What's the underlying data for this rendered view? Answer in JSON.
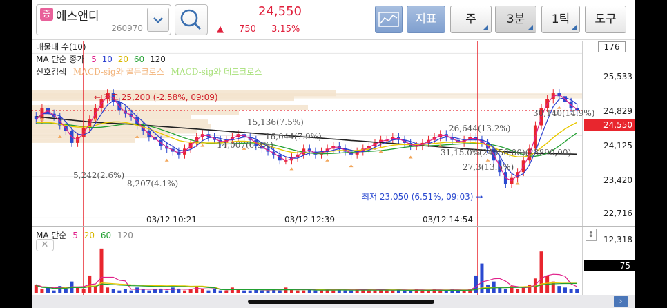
{
  "header": {
    "badge": "증",
    "stock_name": "에스앤디",
    "stock_code": "260970",
    "price": "24,550",
    "change_symbol": "▲",
    "change": "750",
    "change_pct": "3.15%",
    "buttons": {
      "indicator": "지표",
      "week": "주",
      "interval": "3분",
      "tick": "1틱",
      "tools": "도구"
    },
    "icons": [
      "line-chart-icon",
      "search-icon",
      "chevron-down-icon"
    ]
  },
  "chart": {
    "legend": {
      "volume_title": "매물대 수(10)",
      "ma_title": "MA 단순 종가",
      "ma_periods": [
        "5",
        "10",
        "20",
        "60",
        "120"
      ],
      "ma_colors": [
        "#e0208a",
        "#2a3fd0",
        "#e8c800",
        "#22a032",
        "#444444"
      ],
      "signal_title": "신호검색",
      "signal_golden": "MACD-sig와 골든크로스",
      "signal_dead": "MACD-sig와 데드크로스"
    },
    "y_axis": {
      "top_box": "176",
      "ticks": [
        "25,533",
        "24,829",
        "24,125",
        "23,420",
        "22,716"
      ],
      "current_price": "24,550"
    },
    "annotations": {
      "high": "← 최고 25,200 (-2.58%, 09:09)",
      "low": "최저 23,050 (6.51%, 09:03) →",
      "profile_labels": [
        "15,136(7.5%)",
        "16,044(7.9%)",
        "14,007(6.9%)",
        "5,242(2.6%)",
        "8,207(4.1%)",
        "26,644(13.2%)",
        "30,140(14.9%)",
        "31,15.0%",
        "(24050,00)(23890,00)",
        "27,3(13.5%)"
      ]
    },
    "time_labels": [
      "03/12 10:21",
      "03/12 12:39",
      "03/12 14:54"
    ]
  },
  "volume": {
    "legend_title": "MA 단순",
    "ma_periods": [
      "5",
      "20",
      "60",
      "120"
    ],
    "ma_colors": [
      "#e0208a",
      "#e8c800",
      "#22a032",
      "#444444"
    ],
    "y_top": "12,318",
    "box_value": "75",
    "close_label": "✕",
    "scroll_label": "↕",
    "nav_label": "›"
  },
  "chart_data": {
    "type": "candlestick",
    "colors": {
      "up": "#e8262e",
      "down": "#2a49d0",
      "ma5": "#e0208a",
      "ma10": "#2a3fd0",
      "ma20": "#e8c800",
      "ma60": "#22a032",
      "ma120": "#222222"
    },
    "y_ticks": [
      25533,
      24829,
      24125,
      23420,
      22716
    ],
    "ylim": [
      22650,
      25750
    ],
    "current_price": 24550,
    "high": 25200,
    "low": 23050,
    "candles": [
      24400,
      24600,
      24500,
      24450,
      24300,
      24200,
      24000,
      24100,
      24250,
      24400,
      24600,
      24750,
      24850,
      24700,
      24550,
      24500,
      24450,
      24300,
      24200,
      24100,
      24050,
      23950,
      23900,
      23850,
      23800,
      23900,
      24000,
      24100,
      24150,
      24100,
      24050,
      24000,
      24050,
      24100,
      24150,
      24100,
      24050,
      23950,
      23900,
      23850,
      23800,
      23700,
      23700,
      23750,
      23800,
      23900,
      23850,
      23800,
      23850,
      23900,
      23950,
      23900,
      23850,
      23800,
      23850,
      23900,
      23950,
      24000,
      24050,
      24050,
      24100,
      24050,
      24000,
      23950,
      23950,
      24000,
      24050,
      24100,
      24150,
      24100,
      24050,
      24000,
      24050,
      24100,
      24050,
      24000,
      23900,
      23700,
      23500,
      23300,
      23400,
      23500,
      23700,
      23900,
      24300,
      24600,
      24750,
      24850,
      24800,
      24700,
      24600,
      24550
    ],
    "ma20": [
      24350,
      24350,
      24350,
      24340,
      24320,
      24300,
      24280,
      24270,
      24270,
      24280,
      24300,
      24330,
      24350,
      24360,
      24360,
      24350,
      24330,
      24300,
      24270,
      24240,
      24200,
      24160,
      24120,
      24080,
      24040,
      24020,
      24010,
      24000,
      24000,
      24000,
      24000,
      24000,
      24010,
      24020,
      24030,
      24030,
      24020,
      24000,
      23980,
      23950,
      23920,
      23890,
      23860,
      23840,
      23830,
      23830,
      23830,
      23830,
      23840,
      23850,
      23860,
      23870,
      23870,
      23870,
      23870,
      23880,
      23890,
      23900,
      23920,
      23940,
      23960,
      23970,
      23970,
      23970,
      23970,
      23970,
      23980,
      23990,
      24000,
      24010,
      24010,
      24010,
      24010,
      24010,
      24000,
      23990,
      23960,
      23920,
      23870,
      23820,
      23780,
      23760,
      23760,
      23780,
      23840,
      23920,
      24000,
      24090,
      24170,
      24240,
      24300,
      24350
    ],
    "ma120": [
      24450,
      24440,
      24430,
      24420,
      24410,
      24400,
      24390,
      24380,
      24370,
      24360,
      24350,
      24345,
      24340,
      24335,
      24330,
      24325,
      24320,
      24312,
      24305,
      24298,
      24290,
      24282,
      24275,
      24268,
      24260,
      24252,
      24245,
      24238,
      24230,
      24222,
      24215,
      24208,
      24200,
      24192,
      24185,
      24178,
      24170,
      24162,
      24155,
      24148,
      24140,
      24132,
      24125,
      24118,
      24110,
      24102,
      24095,
      24088,
      24080,
      24072,
      24065,
      24058,
      24050,
      24042,
      24035,
      24028,
      24020,
      24012,
      24005,
      23998,
      23990,
      23982,
      23975,
      23968,
      23960,
      23952,
      23945,
      23938,
      23930,
      23922,
      23915,
      23908,
      23900,
      23892,
      23885,
      23878,
      23870,
      23862,
      23855,
      23848,
      23840,
      23835,
      23830,
      23825,
      23820,
      23818,
      23816,
      23814,
      23812,
      23810,
      23808,
      23806
    ],
    "volume": [
      6,
      3,
      4,
      2,
      5,
      3,
      8,
      4,
      3,
      12,
      5,
      30,
      4,
      3,
      2,
      3,
      2,
      4,
      3,
      2,
      3,
      3,
      2,
      4,
      3,
      2,
      3,
      5,
      3,
      2,
      3,
      2,
      2,
      4,
      3,
      2,
      2,
      3,
      2,
      2,
      3,
      2,
      4,
      3,
      2,
      2,
      3,
      2,
      2,
      3,
      2,
      3,
      2,
      2,
      3,
      3,
      2,
      2,
      3,
      2,
      2,
      3,
      2,
      2,
      3,
      2,
      2,
      3,
      2,
      2,
      3,
      2,
      2,
      3,
      12,
      20,
      6,
      8,
      4,
      3,
      5,
      3,
      4,
      6,
      10,
      28,
      12,
      8,
      5,
      4,
      3,
      3
    ],
    "vol_ylim": [
      0,
      35
    ]
  }
}
